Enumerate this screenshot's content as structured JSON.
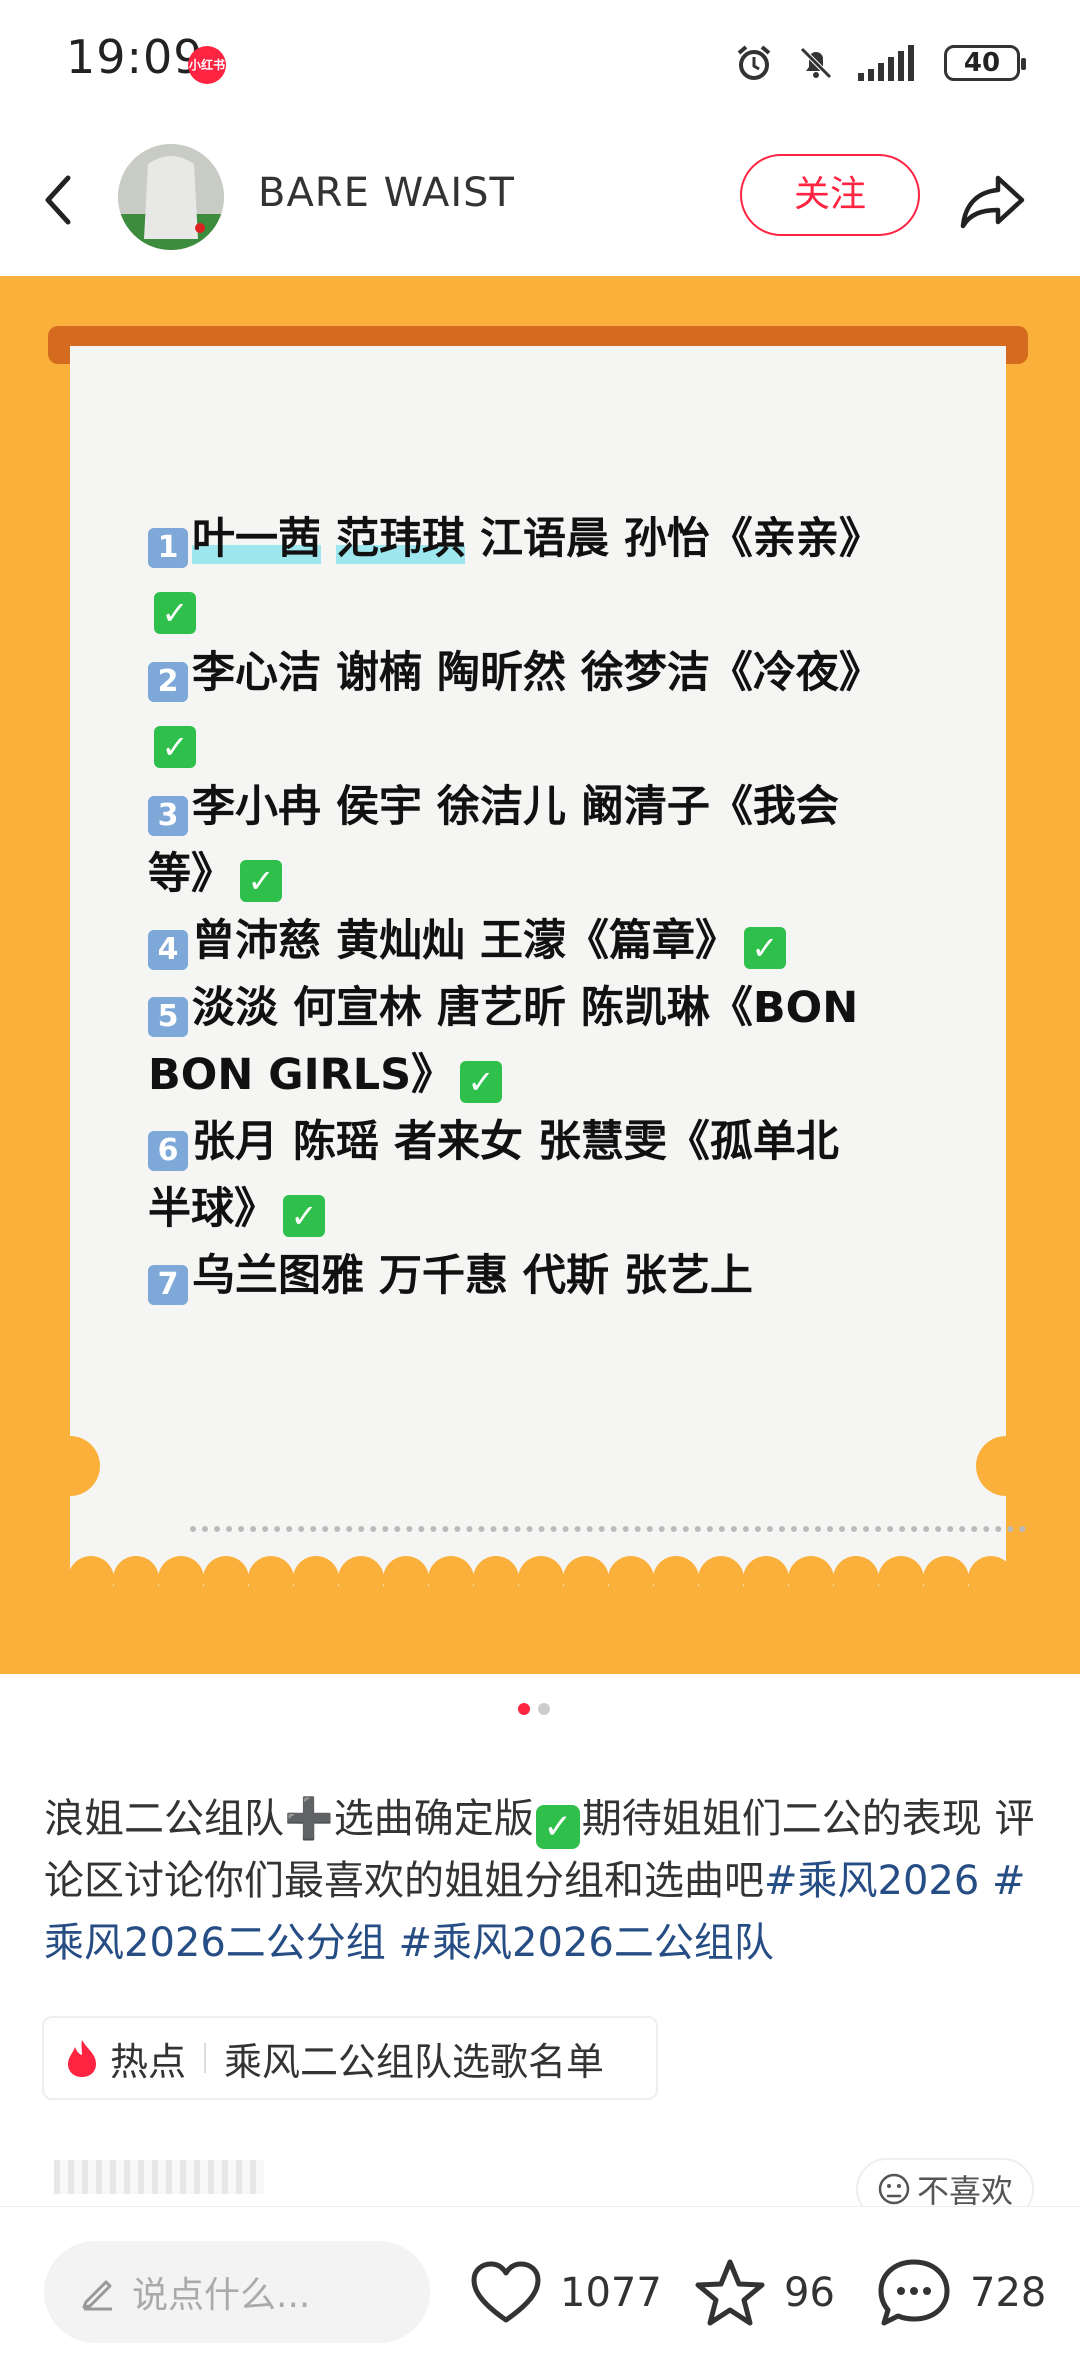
{
  "status_bar": {
    "time": "19:09",
    "app_badge": "小红书",
    "battery": "40"
  },
  "header": {
    "username": "BARE WAIST",
    "follow_label": "关注"
  },
  "note_image": {
    "lines": [
      {
        "num": "1",
        "text": "",
        "hl1": "叶一茜",
        "hl2": "范玮琪",
        "rest": " 江语晨 孙怡《亲亲》"
      },
      {
        "check": "✓"
      },
      {
        "num": "2",
        "text": "李心洁 谢楠 陶昕然 徐梦洁《冷夜》"
      },
      {
        "check": "✓"
      },
      {
        "num": "3",
        "text": "李小冉 侯宇 徐洁儿 阚清子《我会"
      },
      {
        "text": "等》",
        "check": "✓"
      },
      {
        "num": "4",
        "text": "曾沛慈 黄灿灿 王濛《篇章》",
        "check": "✓"
      },
      {
        "num": "5",
        "text": "淡淡 何宣林 唐艺昕 陈凯琳《BON"
      },
      {
        "text": "BON GIRLS》",
        "check": "✓"
      },
      {
        "num": "6",
        "text": "张月 陈瑶 者来女 张慧雯《孤单北"
      },
      {
        "text": "半球》",
        "check": "✓"
      },
      {
        "num": "7",
        "text": "乌兰图雅 万千惠 代斯 张艺上"
      }
    ]
  },
  "caption": {
    "part1": "浪姐二公组队➕选曲确定版",
    "part2": "期待姐姐们二公的表现 评论区讨论你们最喜欢的姐姐分组和选曲吧",
    "tags": [
      "#乘风2026",
      "#乘风2026二公分组",
      "#乘风2026二公组队"
    ]
  },
  "hot_chip": {
    "label": "热点",
    "topic": "乘风二公组队选歌名单"
  },
  "meta": {
    "dislike_label": "不喜欢"
  },
  "bottom_bar": {
    "comment_placeholder": "说点什么...",
    "likes": "1077",
    "collects": "96",
    "comments": "728"
  },
  "colors": {
    "accent": "#ff2442",
    "card_bg": "#fbb03b",
    "tag": "#274d85"
  }
}
